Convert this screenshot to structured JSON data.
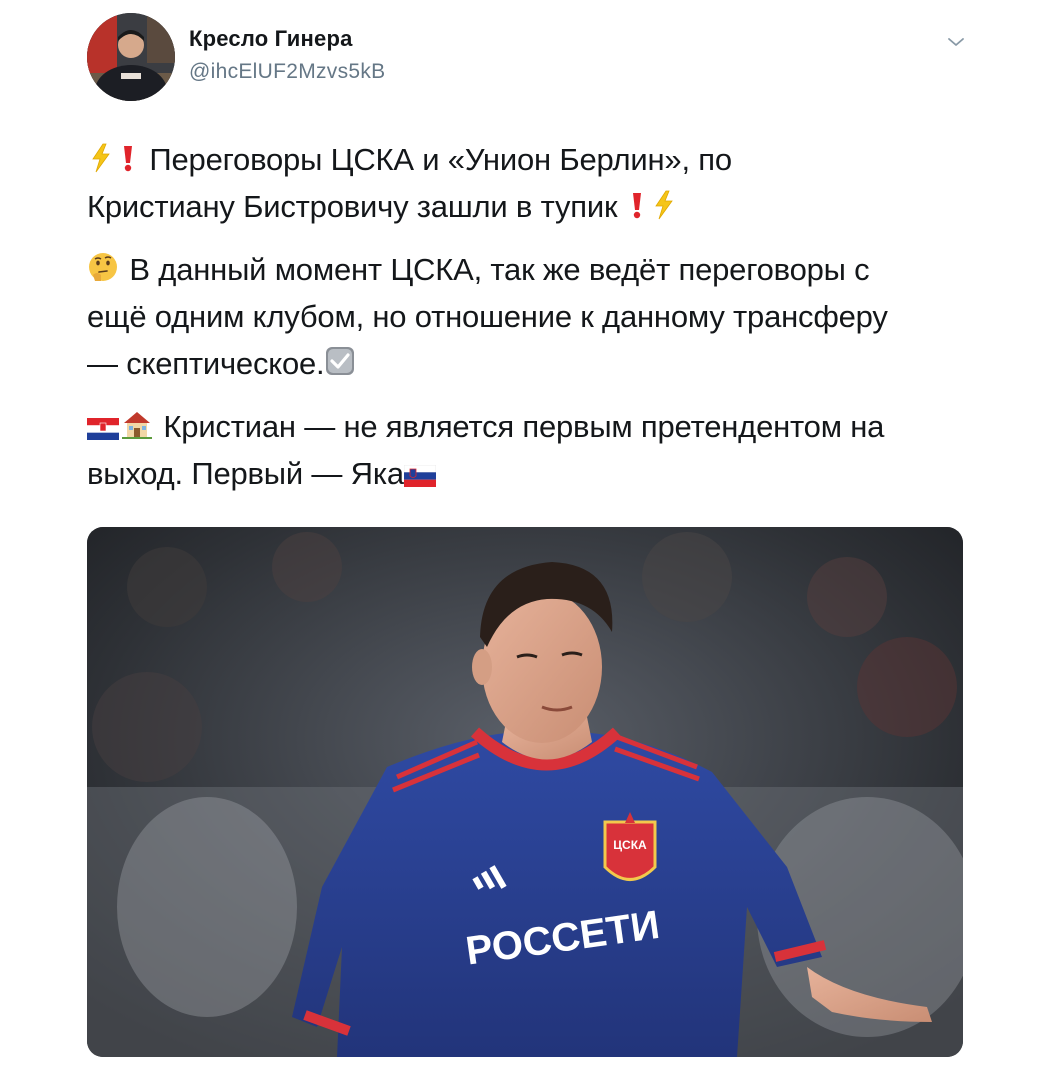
{
  "author": {
    "name": "Кресло Гинера",
    "handle": "@ihcElUF2Mzvs5kB",
    "avatar_icon": "profile-photo"
  },
  "menu": {
    "icon": "chevron-down-icon"
  },
  "tweet": {
    "p1": {
      "line1": "Переговоры ЦСКА и «Унион Берлин», по",
      "line2": "Кристиану Бистровичу зашли в тупик"
    },
    "p2": {
      "line1": "В данный момент ЦСКА, так же ведёт переговоры с",
      "line2": "ещё одним клубом, но отношение к данному трансферу",
      "line3": "— скептическое."
    },
    "p3": {
      "line1": "Кристиан — не является первым претендентом на",
      "line2": "выход. Первый — Яка"
    }
  },
  "photo": {
    "description_icon": "football-player-photo",
    "sponsor_text": "РОССЕТИ",
    "crest_text": "ЦСКА"
  },
  "colors": {
    "handle": "#657786",
    "text": "#14171a",
    "jersey_blue": "#2c3f8f",
    "jersey_red": "#d8323a"
  }
}
